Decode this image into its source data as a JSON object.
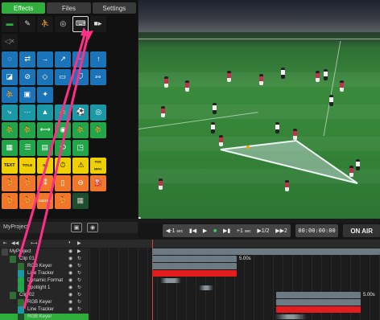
{
  "tabs": [
    {
      "label": "Effects",
      "active": true
    },
    {
      "label": "Files",
      "active": false
    },
    {
      "label": "Settings",
      "active": false
    }
  ],
  "tool_text": {
    "text_label": "TEXT",
    "title_label": "TITLE",
    "score_label": "0 1",
    "score_badge": "2-0",
    "yds_label": "YDS",
    "mph_label": "MPH",
    "custom_label": "CUSTOM"
  },
  "project": {
    "name": "MyProject",
    "save_icon": "save-icon",
    "camera_icon": "camera-icon"
  },
  "transport": {
    "back1": "◀-1",
    "back1_unit": "sec",
    "step_back": "▮◀",
    "play": "▶",
    "stop": "■",
    "step_fwd": "▶▮",
    "fwd1": "+1",
    "fwd1_unit": "sec",
    "slow": "▶1/2",
    "fast": "▶▶2",
    "timecode": "00:00:00:00",
    "on_air": "ON AIR"
  },
  "timeline": {
    "tracks": [
      {
        "name": "MyProject",
        "indent": 0
      },
      {
        "name": "Clip 01",
        "indent": 1
      },
      {
        "name": "RGB Keyer",
        "indent": 2
      },
      {
        "name": "Line Tracker",
        "indent": 2
      },
      {
        "name": "Dynamic Format",
        "indent": 2
      },
      {
        "name": "Spotlight 1",
        "indent": 2
      },
      {
        "name": "Clip 02",
        "indent": 1
      },
      {
        "name": "RGB Keyer",
        "indent": 2
      },
      {
        "name": "Line Tracker",
        "indent": 2
      },
      {
        "name": "RGB Keyer",
        "indent": 2
      }
    ],
    "clip1_duration": "5.00s",
    "clip2_duration": "5.00s"
  },
  "colors": {
    "accent_green": "#2fae3c",
    "tool_blue": "#1c74b8",
    "tool_teal": "#1b98a6",
    "tool_green": "#23a54a",
    "tool_orange": "#f1772a",
    "tool_yellow": "#f0d000",
    "clip_gray": "#6c7a84",
    "clip_red": "#e31d1d",
    "playhead": "#e23b3b",
    "arrow_pink": "#ff2f87"
  }
}
